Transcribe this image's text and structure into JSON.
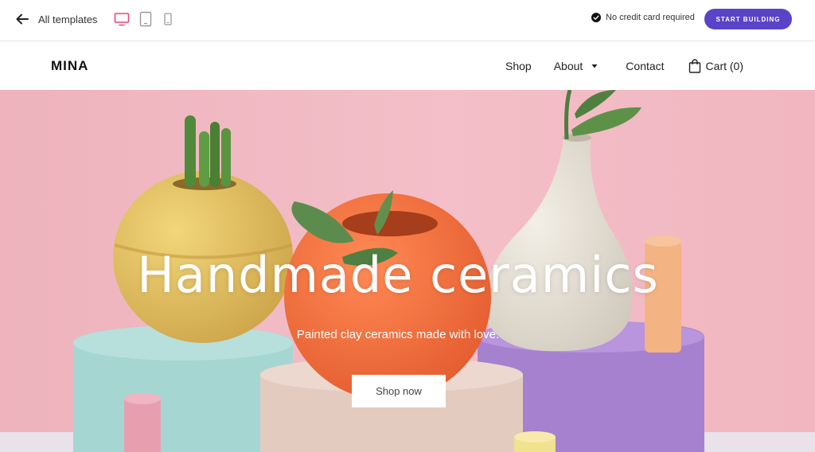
{
  "editor_bar": {
    "back_label": "All templates",
    "device_icons": [
      "desktop-icon",
      "tablet-icon",
      "mobile-icon"
    ],
    "active_device": "desktop",
    "notice": "No credit card required",
    "cta_label": "START BUILDING",
    "accent_color": "#5a43c6",
    "active_device_color": "#e8457f"
  },
  "site": {
    "logo": "MINA",
    "nav": {
      "shop": "Shop",
      "about": "About",
      "contact": "Contact",
      "cart": "Cart (0)"
    }
  },
  "hero": {
    "title": "Handmade ceramics",
    "subtitle": "Painted clay ceramics made with love.",
    "button_label": "Shop now",
    "background_color": "#f2b9c2"
  }
}
